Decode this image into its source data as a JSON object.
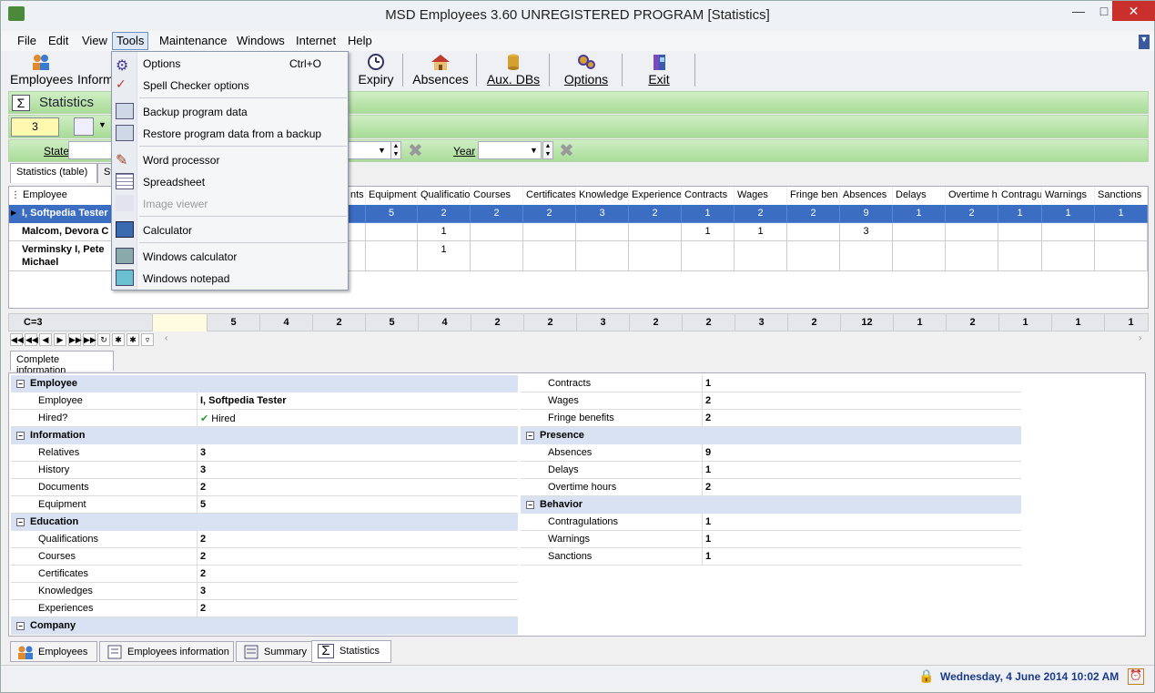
{
  "window": {
    "title": "MSD Employees 3.60 UNREGISTERED PROGRAM [Statistics]"
  },
  "menubar": {
    "items": [
      "File",
      "Edit",
      "View",
      "Tools",
      "Maintenance",
      "Windows",
      "Internet",
      "Help"
    ]
  },
  "toolbar": {
    "employees": "Employees",
    "information": "Informa",
    "expiry": "Expiry",
    "absences": "Absences",
    "aux_dbs": "Aux. DBs",
    "options": "Options",
    "exit": "Exit"
  },
  "stats": {
    "title": "Statistics",
    "count": "3"
  },
  "filter": {
    "state_label": "State",
    "year_label": "Year"
  },
  "tabs": {
    "table": "Statistics (table)",
    "second": "Sta"
  },
  "grid": {
    "columns": [
      "Employee",
      "nts",
      "Equipment",
      "Qualificatio",
      "Courses",
      "Certificates",
      "Knowledge",
      "Experience",
      "Contracts",
      "Wages",
      "Fringe ben",
      "Absences",
      "Delays",
      "Overtime h",
      "Contragu",
      "Warnings",
      "Sanctions"
    ],
    "rows": [
      {
        "name": "I, Softpedia Tester",
        "values": [
          "",
          "5",
          "2",
          "2",
          "2",
          "3",
          "2",
          "1",
          "2",
          "2",
          "9",
          "1",
          "2",
          "1",
          "1",
          "1"
        ]
      },
      {
        "name": "Malcom, Devora C",
        "values": [
          "",
          "",
          "1",
          "",
          "",
          "",
          "",
          "1",
          "1",
          "",
          "3",
          "",
          "",
          "",
          "",
          ""
        ]
      },
      {
        "name": "Verminsky I, Pete",
        "name2": "Michael",
        "values": [
          "",
          "",
          "1",
          "",
          "",
          "",
          "",
          "",
          "",
          "",
          "",
          "",
          "",
          "",
          "",
          ""
        ]
      }
    ],
    "footer_count": "C=3",
    "footer": [
      "5",
      "4",
      "2",
      "5",
      "4",
      "2",
      "2",
      "3",
      "2",
      "2",
      "3",
      "2",
      "12",
      "1",
      "2",
      "1",
      "1",
      "1"
    ]
  },
  "detail": {
    "tab": "Complete information",
    "left": [
      {
        "section": "Employee"
      },
      {
        "k": "Employee",
        "v": "I, Softpedia Tester"
      },
      {
        "k": "Hired?",
        "v": "Hired"
      },
      {
        "section": "Information"
      },
      {
        "k": "Relatives",
        "v": "3"
      },
      {
        "k": "History",
        "v": "3"
      },
      {
        "k": "Documents",
        "v": "2"
      },
      {
        "k": "Equipment",
        "v": "5"
      },
      {
        "section": "Education"
      },
      {
        "k": "Qualifications",
        "v": "2"
      },
      {
        "k": "Courses",
        "v": "2"
      },
      {
        "k": "Certificates",
        "v": "2"
      },
      {
        "k": "Knowledges",
        "v": "3"
      },
      {
        "k": "Experiences",
        "v": "2"
      },
      {
        "section": "Company"
      }
    ],
    "right": [
      {
        "k": "Contracts",
        "v": "1"
      },
      {
        "k": "Wages",
        "v": "2"
      },
      {
        "k": "Fringe benefits",
        "v": "2"
      },
      {
        "section": "Presence"
      },
      {
        "k": "Absences",
        "v": "9"
      },
      {
        "k": "Delays",
        "v": "1"
      },
      {
        "k": "Overtime hours",
        "v": "2"
      },
      {
        "section": "Behavior"
      },
      {
        "k": "Contragulations",
        "v": "1"
      },
      {
        "k": "Warnings",
        "v": "1"
      },
      {
        "k": "Sanctions",
        "v": "1"
      }
    ]
  },
  "bottom_tabs": [
    "Employees",
    "Employees information",
    "Summary",
    "Statistics"
  ],
  "status": {
    "date": "Wednesday, 4 June 2014",
    "time": "10:02 AM"
  },
  "tools_menu": {
    "options": "Options",
    "options_shortcut": "Ctrl+O",
    "spell": "Spell Checker options",
    "backup": "Backup program data",
    "restore": "Restore program data from a backup",
    "word": "Word processor",
    "spreadsheet": "Spreadsheet",
    "image": "Image viewer",
    "calculator": "Calculator",
    "wincalc": "Windows calculator",
    "notepad": "Windows notepad"
  }
}
